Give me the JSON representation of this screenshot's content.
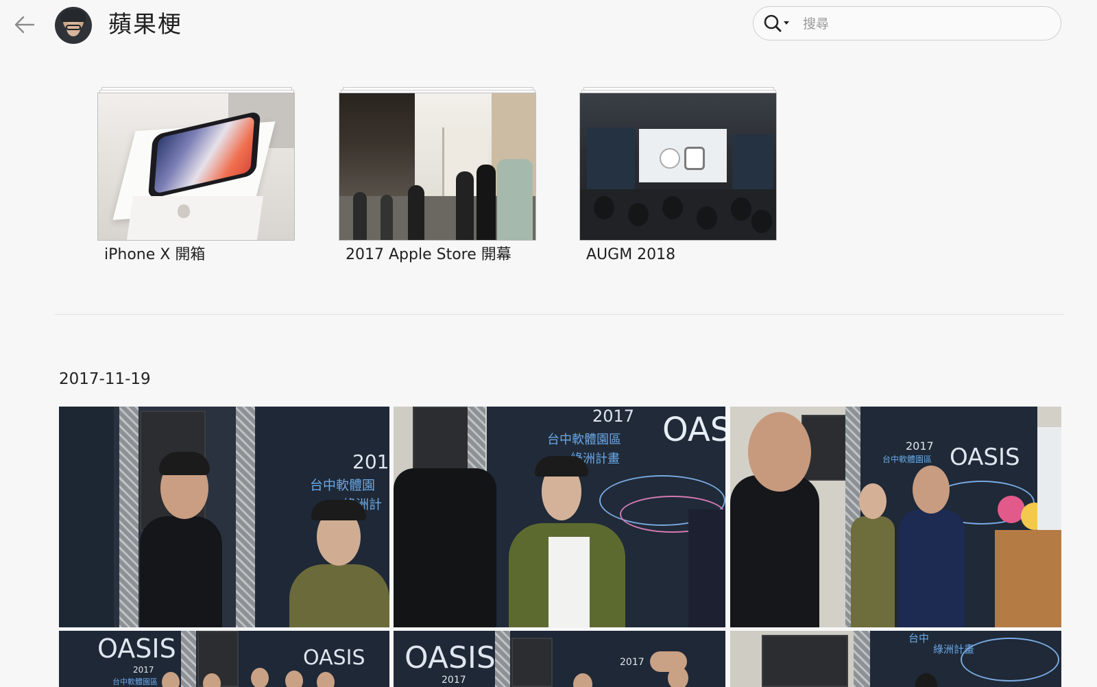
{
  "header": {
    "back_icon": "arrow-left-icon",
    "title": "蘋果梗",
    "search": {
      "icon": "search-icon",
      "placeholder": "搜尋",
      "value": ""
    }
  },
  "albums": [
    {
      "label": "iPhone X 開箱"
    },
    {
      "label": "2017 Apple Store 開幕"
    },
    {
      "label": "AUGM 2018"
    }
  ],
  "section": {
    "date": "2017-11-19"
  },
  "photos": {
    "p1": {
      "t1": "201",
      "t2": "台中軟體園",
      "t3": "綠洲計"
    },
    "p2": {
      "t1": "2017",
      "t2": "台中軟體園區",
      "t3": "綠洲計畫",
      "t4": "OAS"
    },
    "p3": {
      "t1": "2017",
      "t2": "台中軟體園區",
      "t3": "OASIS"
    },
    "p4": {
      "t1": "OASIS",
      "t2": "2017",
      "t3": "台中軟體園區",
      "t4": "OASIS"
    },
    "p5": {
      "t1": "OASIS",
      "t2": "2017",
      "t3": "2017"
    },
    "p6": {
      "t1": "台中",
      "t2": "綠洲計畫"
    }
  },
  "colors": {
    "background": "#f7f7f7",
    "divider": "#e2e2e2",
    "search_border": "#cfcfcf"
  }
}
